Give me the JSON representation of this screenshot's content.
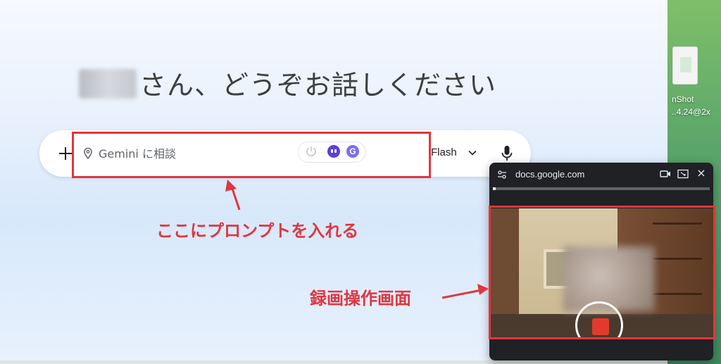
{
  "greeting": {
    "suffix": "さん、どうぞお話しください"
  },
  "prompt_bar": {
    "placeholder": "Gemini に相談",
    "model_label": "Flash",
    "ext_g_letter": "G"
  },
  "annotations": {
    "prompt_label": "ここにプロンプトを入れる",
    "recording_label": "録画操作画面",
    "color": "#e0363f"
  },
  "pip": {
    "url": "docs.google.com",
    "close": "×",
    "progress": 0.01
  },
  "desktop": {
    "file_line1": "nShot",
    "file_line2": "..4.24@2x"
  },
  "icons": [
    "plus-icon",
    "location-icon",
    "power-icon",
    "bot-icon",
    "g-icon",
    "chevron-down-icon",
    "mic-icon",
    "tune-icon",
    "camera-icon",
    "expand-icon",
    "close-icon"
  ]
}
